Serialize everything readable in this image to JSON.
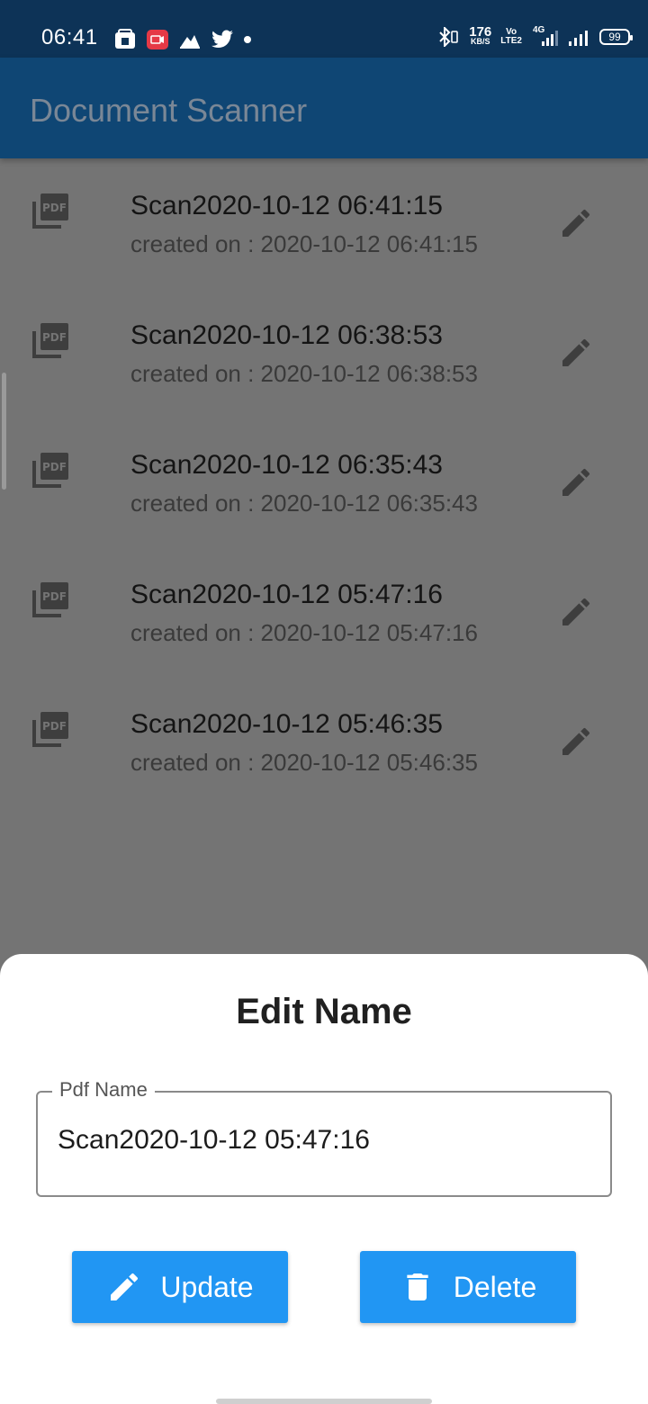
{
  "status_bar": {
    "time": "06:41",
    "net_speed_value": "176",
    "net_speed_unit": "KB/S",
    "volte_top": "Vo",
    "volte_bottom": "LTE2",
    "network_type": "4G",
    "battery": "99"
  },
  "app_bar": {
    "title": "Document Scanner"
  },
  "documents": [
    {
      "name": "Scan2020-10-12 06:41:15",
      "created": "created on : 2020-10-12 06:41:15"
    },
    {
      "name": "Scan2020-10-12 06:38:53",
      "created": "created on : 2020-10-12 06:38:53"
    },
    {
      "name": "Scan2020-10-12 06:35:43",
      "created": "created on : 2020-10-12 06:35:43"
    },
    {
      "name": "Scan2020-10-12 05:47:16",
      "created": "created on : 2020-10-12 05:47:16"
    },
    {
      "name": "Scan2020-10-12 05:46:35",
      "created": "created on : 2020-10-12 05:46:35"
    }
  ],
  "sheet": {
    "title": "Edit Name",
    "field_label": "Pdf Name",
    "field_value": "Scan2020-10-12 05:47:16",
    "update_label": "Update",
    "delete_label": "Delete"
  },
  "colors": {
    "status_bar": "#0d3357",
    "app_bar": "#0f4674",
    "scrim_background": "#747474",
    "button": "#2196f3"
  },
  "icons": {
    "list_item": "pdf-icon",
    "list_action": "edit-icon",
    "update": "pencil-icon",
    "delete": "trash-icon"
  }
}
